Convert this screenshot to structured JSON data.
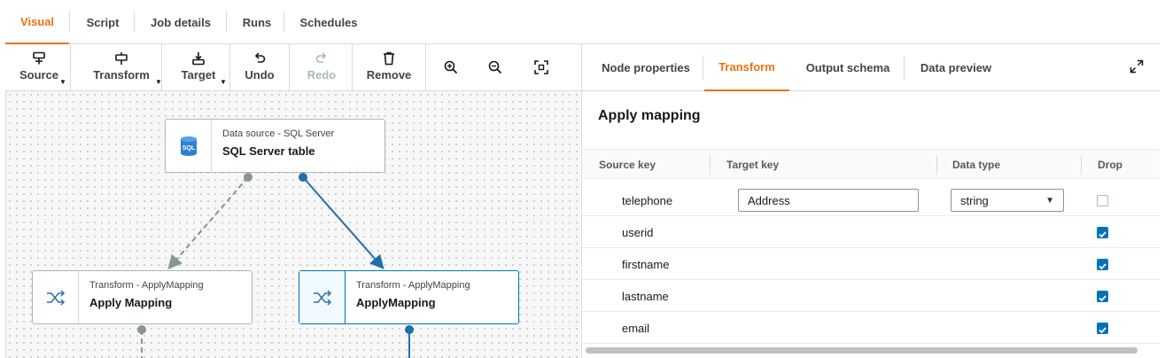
{
  "top_tabs": [
    "Visual",
    "Script",
    "Job details",
    "Runs",
    "Schedules"
  ],
  "toolbar": {
    "source": "Source",
    "transform": "Transform",
    "target": "Target",
    "undo": "Undo",
    "redo": "Redo",
    "remove": "Remove"
  },
  "nodes": {
    "sql_source": {
      "type": "Data source - SQL Server",
      "name": "SQL Server table",
      "icon_text": "SQL"
    },
    "apply_mapping_1": {
      "type": "Transform - ApplyMapping",
      "name": "Apply Mapping"
    },
    "apply_mapping_2": {
      "type": "Transform - ApplyMapping",
      "name": "ApplyMapping"
    }
  },
  "panel": {
    "tabs": [
      "Node properties",
      "Transform",
      "Output schema",
      "Data preview"
    ],
    "title": "Apply mapping",
    "columns": [
      "Source key",
      "Target key",
      "Data type",
      "Drop"
    ],
    "rows": [
      {
        "source_key": "telephone",
        "target_key": "Address",
        "data_type": "string",
        "drop": false
      },
      {
        "source_key": "userid",
        "drop": true
      },
      {
        "source_key": "firstname",
        "drop": true
      },
      {
        "source_key": "lastname",
        "drop": true
      },
      {
        "source_key": "email",
        "drop": true
      }
    ]
  },
  "colors": {
    "accent": "#ec7211",
    "selection": "#0073bb",
    "checkbox": "#0073bb"
  }
}
